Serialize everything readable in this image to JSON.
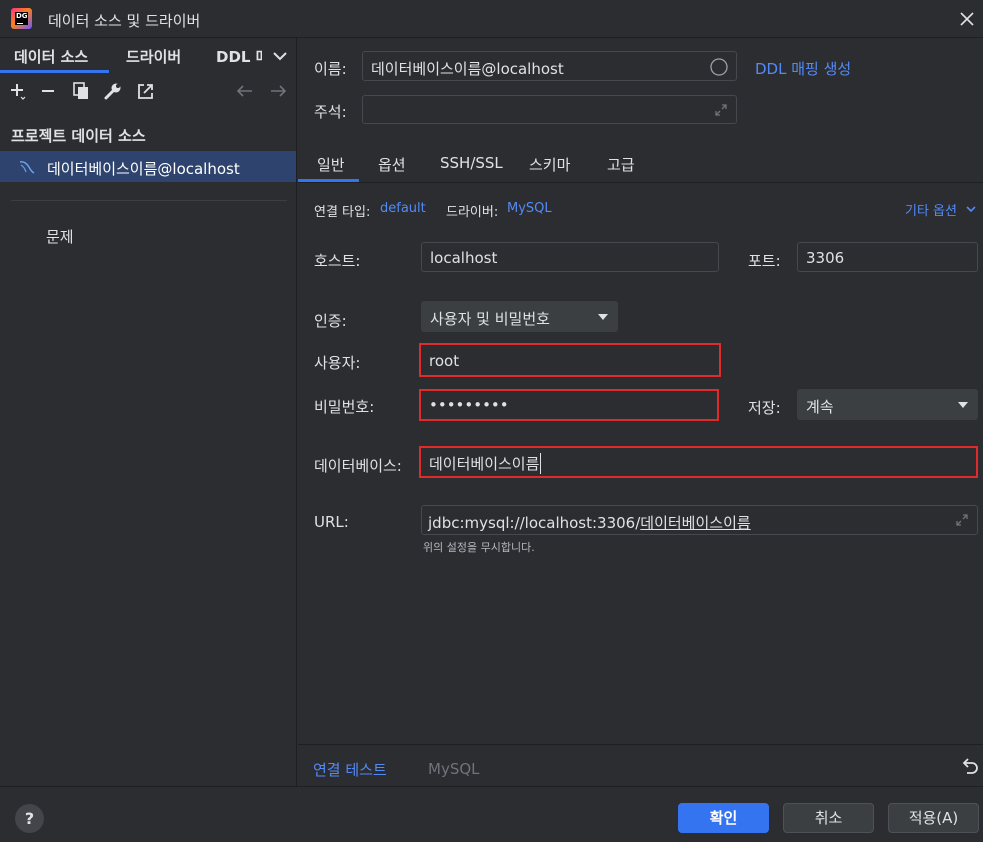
{
  "window": {
    "title": "데이터 소스 및 드라이버"
  },
  "left": {
    "tabs": [
      "데이터 소스",
      "드라이버",
      "DDL 매핑"
    ],
    "section_title": "프로젝트 데이터 소스",
    "datasource": "데이터베이스이름@localhost",
    "problems": "문제"
  },
  "header": {
    "name_label": "이름:",
    "name_value": "데이터베이스이름@localhost",
    "ddl_link": "DDL 매핑 생성",
    "comment_label": "주석:",
    "comment_value": ""
  },
  "tabs": [
    "일반",
    "옵션",
    "SSH/SSL",
    "스키마",
    "고급"
  ],
  "general": {
    "connection_type_label": "연결 타입:",
    "connection_type_value": "default",
    "driver_label": "드라이버:",
    "driver_value": "MySQL",
    "more_options": "기타 옵션",
    "host_label": "호스트:",
    "host_value": "localhost",
    "port_label": "포트:",
    "port_value": "3306",
    "auth_label": "인증:",
    "auth_value": "사용자 및 비밀번호",
    "user_label": "사용자:",
    "user_value": "root",
    "password_label": "비밀번호:",
    "password_value": "•••••••••",
    "save_label": "저장:",
    "save_value": "계속",
    "database_label": "데이터베이스:",
    "database_value": "데이터베이스이름",
    "url_label": "URL:",
    "url_prefix": "jdbc:mysql://localhost:3306/",
    "url_db": "데이터베이스이름",
    "url_hint": "위의 설정을 무시합니다."
  },
  "bottom": {
    "test_connection": "연결 테스트",
    "driver_name": "MySQL"
  },
  "footer": {
    "help": "?",
    "ok": "확인",
    "cancel": "취소",
    "apply": "적용(A)"
  },
  "colors": {
    "accent": "#3574f0",
    "link": "#548af7",
    "highlight_border": "#e02b2b",
    "selection": "#2e436e"
  }
}
